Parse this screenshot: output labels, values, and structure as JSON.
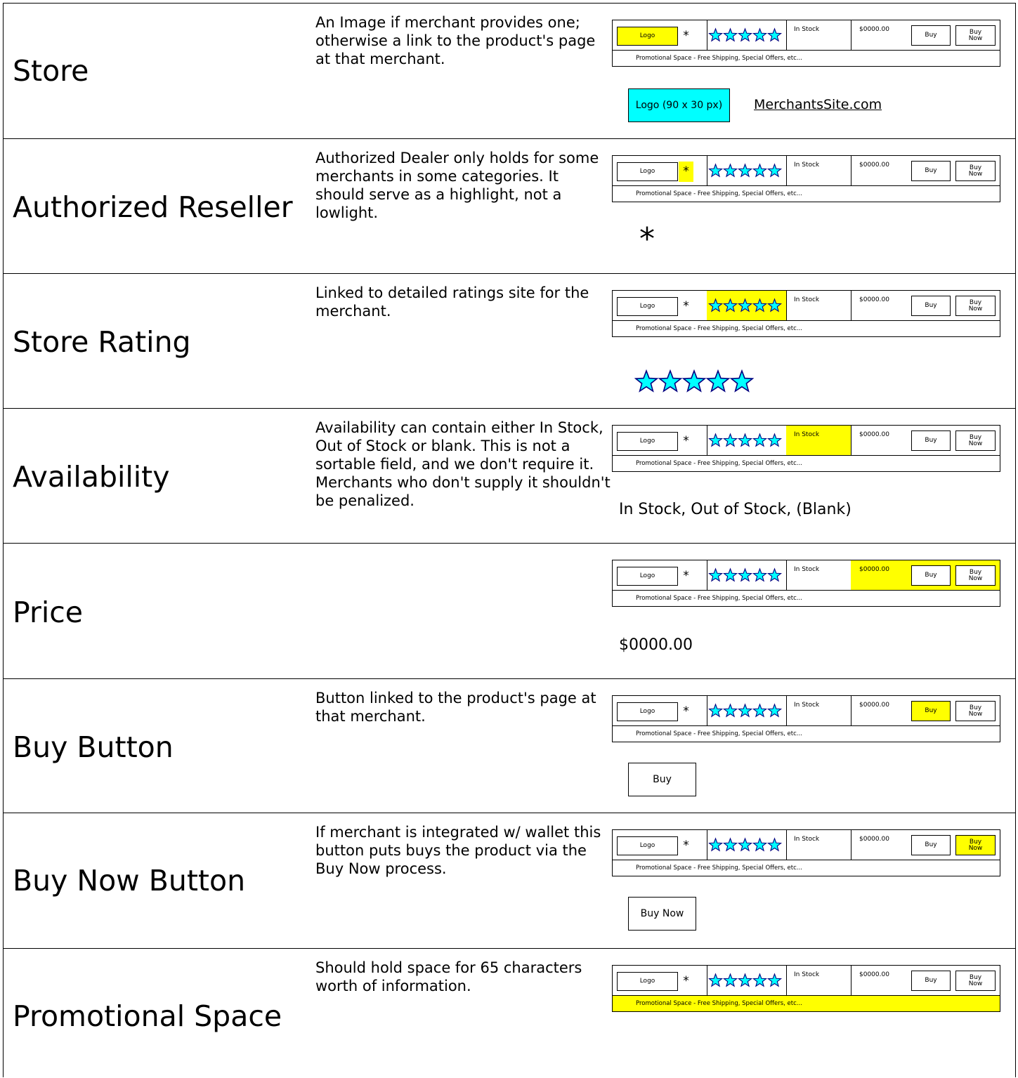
{
  "rows": [
    {
      "label": "Store",
      "desc": "An Image if merchant provides one; otherwise a link to the product's page at that merchant.",
      "highlight": "logo"
    },
    {
      "label": "Authorized Reseller",
      "desc": "Authorized Dealer only holds for some merchants in some categories. It should serve as a highlight, not a lowlight.",
      "highlight": "asterisk"
    },
    {
      "label": "Store Rating",
      "desc": "Linked to detailed ratings site for the merchant.",
      "highlight": "stars"
    },
    {
      "label": "Availability",
      "desc": "Availability can contain either In Stock, Out of Stock or blank. This is not a sortable field, and we don't require it. Merchants who don't supply it shouldn't be penalized.",
      "highlight": "stock"
    },
    {
      "label": "Price",
      "desc": "",
      "highlight": "price"
    },
    {
      "label": "Buy Button",
      "desc": "Button linked to the product's page at that merchant.",
      "highlight": "buy"
    },
    {
      "label": "Buy Now Button",
      "desc": "If merchant is integrated w/ wallet this button puts buys the product via the Buy Now process.",
      "highlight": "buynow"
    },
    {
      "label": "Promotional Space",
      "desc": "Should hold space for 65 characters worth of information.",
      "highlight": "promo"
    }
  ],
  "mockup": {
    "logo": "Logo",
    "asterisk": "*",
    "stock": "In Stock",
    "price": "$0000.00",
    "buy": "Buy",
    "buy_now_line1": "Buy",
    "buy_now_line2": "Now",
    "promo": "Promotional Space - Free Shipping, Special Offers, etc..."
  },
  "details": {
    "logo_box": "Logo (90 x 30 px)",
    "site_link": "MerchantsSite.com",
    "asterisk": "*",
    "availability": "In Stock, Out of Stock, (Blank)",
    "price": "$0000.00",
    "buy": "Buy",
    "buy_now": "Buy Now"
  },
  "colors": {
    "highlight": "#ffff00",
    "accent": "#00ffff",
    "star_stroke": "#000080"
  }
}
